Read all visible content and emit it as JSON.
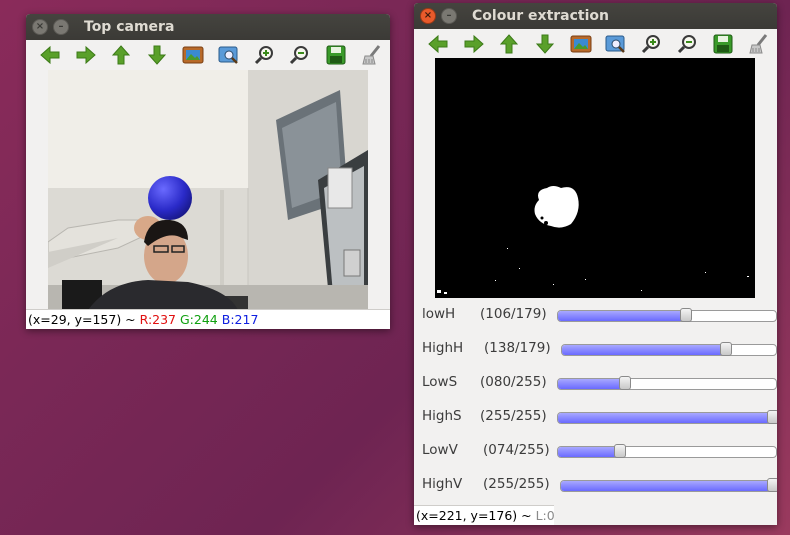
{
  "windows": {
    "top_camera": {
      "title": "Top camera",
      "status": {
        "coords": "(x=29, y=157) ~ ",
        "r": "R:237",
        "g": "G:244",
        "b": "B:217"
      }
    },
    "colour_extraction": {
      "title": "Colour extraction",
      "status": {
        "coords": "(x=221, y=176) ~ ",
        "l": "L:0"
      },
      "sliders": [
        {
          "label": "lowH",
          "value_text": "(106/179)",
          "value": 106,
          "max": 179
        },
        {
          "label": "HighH",
          "value_text": "(138/179)",
          "value": 138,
          "max": 179
        },
        {
          "label": "LowS",
          "value_text": "(080/255)",
          "value": 80,
          "max": 255
        },
        {
          "label": "HighS",
          "value_text": "(255/255)",
          "value": 255,
          "max": 255
        },
        {
          "label": "LowV",
          "value_text": "(074/255)",
          "value": 74,
          "max": 255
        },
        {
          "label": "HighV",
          "value_text": "(255/255)",
          "value": 255,
          "max": 255
        }
      ]
    }
  },
  "toolbar_icons": [
    "arrow-left-icon",
    "arrow-right-icon",
    "arrow-up-icon",
    "arrow-down-icon",
    "image-icon",
    "zoom-fit-icon",
    "zoom-in-icon",
    "zoom-out-icon",
    "save-icon",
    "properties-icon"
  ],
  "colors": {
    "status_r": "#e01010",
    "status_g": "#10a010",
    "status_b": "#1020e0",
    "status_l": "#8a8a8a",
    "slider_fill": "#7a7aff"
  }
}
